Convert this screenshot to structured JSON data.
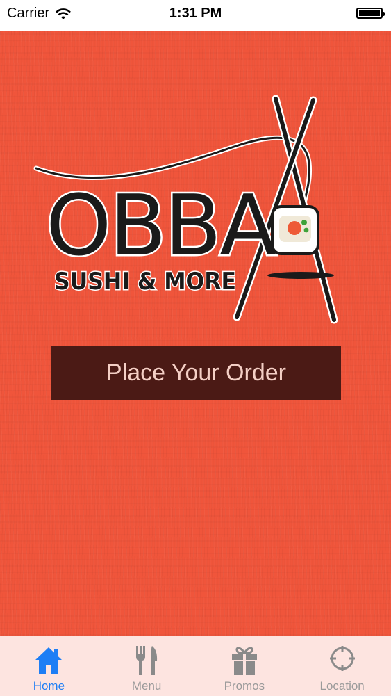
{
  "status_bar": {
    "carrier": "Carrier",
    "time": "1:31 PM",
    "wifi_icon": "wifi-icon",
    "battery_icon": "battery-icon"
  },
  "logo": {
    "brand_text": "OBBA",
    "tagline": "SUSHI & MORE"
  },
  "order_button": {
    "label": "Place Your Order"
  },
  "tabs": [
    {
      "label": "Home",
      "icon": "home-icon",
      "active": true
    },
    {
      "label": "Menu",
      "icon": "fork-knife-icon",
      "active": false
    },
    {
      "label": "Promos",
      "icon": "gift-icon",
      "active": false
    },
    {
      "label": "Location",
      "icon": "crosshair-icon",
      "active": false
    }
  ],
  "colors": {
    "background": "#f0553b",
    "button_bg": "#4b1a15",
    "button_text": "#f4cfc5",
    "tab_bar_bg": "#fde4e0",
    "tab_active": "#1e7ef5",
    "tab_inactive": "#9a9a9a"
  }
}
